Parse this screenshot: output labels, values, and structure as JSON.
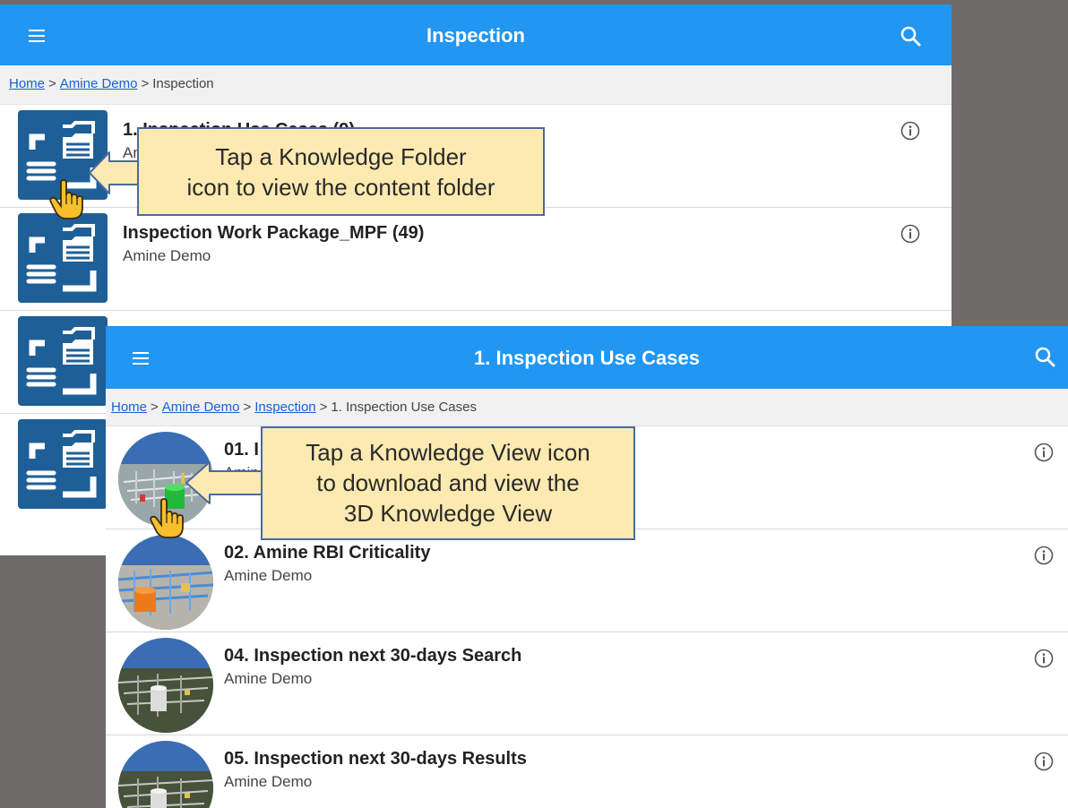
{
  "screen_a": {
    "title": "Inspection",
    "breadcrumb": {
      "links": [
        "Home",
        "Amine Demo"
      ],
      "current": "Inspection",
      "separator": ">"
    },
    "items": [
      {
        "title": "1. Inspection Use Cases (9)",
        "subtitle": "Am",
        "icon": "knowledge-folder-icon"
      },
      {
        "title": "Inspection Work Package_MPF (49)",
        "subtitle": "Amine Demo",
        "icon": "knowledge-folder-icon"
      },
      {
        "title": "",
        "subtitle": "",
        "icon": "knowledge-folder-icon"
      },
      {
        "title": "",
        "subtitle": "",
        "icon": "knowledge-folder-icon"
      }
    ]
  },
  "screen_b": {
    "title": "1. Inspection Use Cases",
    "breadcrumb": {
      "links": [
        "Home",
        "Amine Demo",
        "Inspection"
      ],
      "current": "1. Inspection Use Cases",
      "separator": ">"
    },
    "items": [
      {
        "title": "01. I",
        "subtitle": "Amin",
        "icon": "knowledge-view-icon"
      },
      {
        "title": "02. Amine RBI Criticality",
        "subtitle": "Amine Demo",
        "icon": "knowledge-view-icon"
      },
      {
        "title": "04. Inspection next 30-days Search",
        "subtitle": "Amine Demo",
        "icon": "knowledge-view-icon"
      },
      {
        "title": "05. Inspection  next 30-days Results",
        "subtitle": "Amine Demo",
        "icon": "knowledge-view-icon"
      }
    ]
  },
  "callouts": {
    "folder": {
      "line1": "Tap a Knowledge Folder",
      "line2": "icon to view the content  folder"
    },
    "view": {
      "line1": "Tap a Knowledge View icon",
      "line2": "to download and view the",
      "line3": "3D Knowledge View"
    }
  },
  "colors": {
    "app_bar": "#2196f3",
    "folder_tile": "#1f5f97",
    "callout_fill": "#fdeab0",
    "callout_border": "#4a6aa0",
    "link": "#1a5fd6",
    "background": "#6f6b6b"
  }
}
